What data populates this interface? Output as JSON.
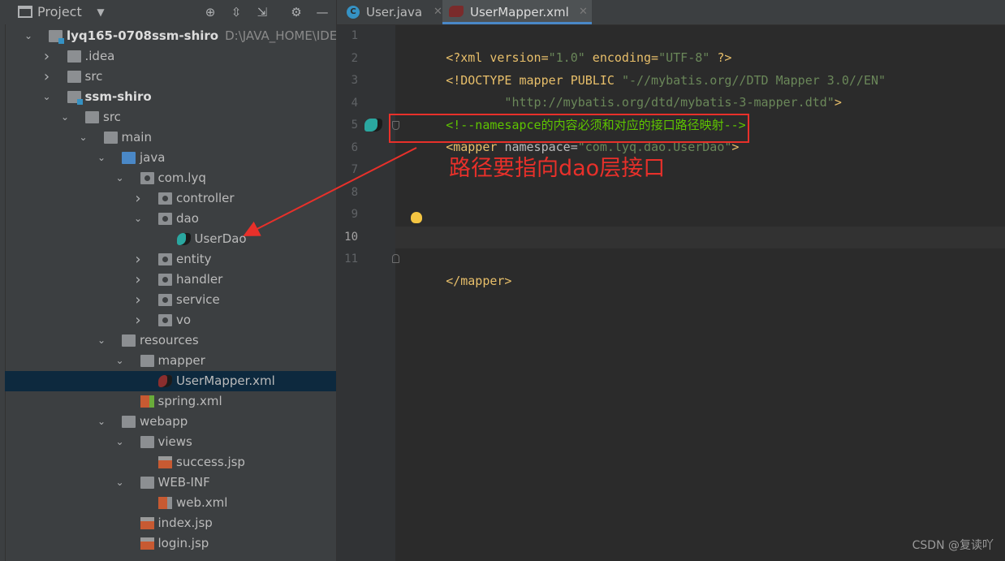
{
  "project_panel": {
    "title": "Project",
    "tree": [
      {
        "label": "lyq165-0708ssm-shiro",
        "path": "D:\\JAVA_HOME\\IDEADao",
        "depth": 0,
        "chevron": "down",
        "icon": "module-folder-icon",
        "bold": true
      },
      {
        "label": ".idea",
        "depth": 1,
        "chevron": "right",
        "icon": "folder-icon"
      },
      {
        "label": "src",
        "depth": 1,
        "chevron": "right",
        "icon": "folder-icon"
      },
      {
        "label": "ssm-shiro",
        "depth": 1,
        "chevron": "down",
        "icon": "module-folder-icon",
        "bold": true
      },
      {
        "label": "src",
        "depth": 2,
        "chevron": "down",
        "icon": "folder-icon"
      },
      {
        "label": "main",
        "depth": 3,
        "chevron": "down",
        "icon": "folder-icon"
      },
      {
        "label": "java",
        "depth": 4,
        "chevron": "down",
        "icon": "source-folder-icon"
      },
      {
        "label": "com.lyq",
        "depth": 5,
        "chevron": "down",
        "icon": "package-icon"
      },
      {
        "label": "controller",
        "depth": 6,
        "chevron": "right",
        "icon": "package-icon"
      },
      {
        "label": "dao",
        "depth": 6,
        "chevron": "down",
        "icon": "package-icon"
      },
      {
        "label": "UserDao",
        "depth": 7,
        "chevron": "",
        "icon": "mybatis-bird-icon"
      },
      {
        "label": "entity",
        "depth": 6,
        "chevron": "right",
        "icon": "package-icon"
      },
      {
        "label": "handler",
        "depth": 6,
        "chevron": "right",
        "icon": "package-icon"
      },
      {
        "label": "service",
        "depth": 6,
        "chevron": "right",
        "icon": "package-icon"
      },
      {
        "label": "vo",
        "depth": 6,
        "chevron": "right",
        "icon": "package-icon"
      },
      {
        "label": "resources",
        "depth": 4,
        "chevron": "down",
        "icon": "resources-folder-icon"
      },
      {
        "label": "mapper",
        "depth": 5,
        "chevron": "down",
        "icon": "folder-icon"
      },
      {
        "label": "UserMapper.xml",
        "depth": 6,
        "chevron": "",
        "icon": "mybatis-xml-icon",
        "selected": true
      },
      {
        "label": "spring.xml",
        "depth": 5,
        "chevron": "",
        "icon": "spring-xml-icon"
      },
      {
        "label": "webapp",
        "depth": 4,
        "chevron": "down",
        "icon": "web-folder-icon"
      },
      {
        "label": "views",
        "depth": 5,
        "chevron": "down",
        "icon": "folder-icon"
      },
      {
        "label": "success.jsp",
        "depth": 6,
        "chevron": "",
        "icon": "jsp-icon"
      },
      {
        "label": "WEB-INF",
        "depth": 5,
        "chevron": "down",
        "icon": "folder-icon"
      },
      {
        "label": "web.xml",
        "depth": 6,
        "chevron": "",
        "icon": "web-xml-icon"
      },
      {
        "label": "index.jsp",
        "depth": 5,
        "chevron": "",
        "icon": "jsp-icon"
      },
      {
        "label": "login.jsp",
        "depth": 5,
        "chevron": "",
        "icon": "jsp-icon"
      }
    ]
  },
  "editor": {
    "tabs": [
      {
        "label": "User.java",
        "active": false,
        "icon": "java-class-icon"
      },
      {
        "label": "UserMapper.xml",
        "active": true,
        "icon": "mybatis-xml-icon"
      }
    ],
    "line_numbers": [
      "1",
      "2",
      "3",
      "4",
      "5",
      "6",
      "7",
      "8",
      "9",
      "10",
      "11"
    ],
    "current_line": "10",
    "code": {
      "l1_a": "<?xml version=",
      "l1_b": "\"1.0\"",
      "l1_c": " encoding=",
      "l1_d": "\"UTF-8\"",
      "l1_e": " ?>",
      "l2_a": "<!DOCTYPE mapper PUBLIC ",
      "l2_b": "\"-//mybatis.org//DTD Mapper 3.0//EN\"",
      "l3_a": "        \"http://mybatis.org/dtd/mybatis-3-mapper.dtd\"",
      "l3_b": ">",
      "l4": "<!--namesapce的内容必须和对应的接口路径映射-->",
      "l5_a": "<mapper ",
      "l5_b": "namespace",
      "l5_c": "=",
      "l5_d": "\"com.lyq.dao.UserDao\"",
      "l5_e": ">",
      "l11": "</mapper>"
    },
    "annotation_text": "路径要指向dao层接口",
    "annotation_color": "#e8302a"
  },
  "watermark": "CSDN @复读吖"
}
